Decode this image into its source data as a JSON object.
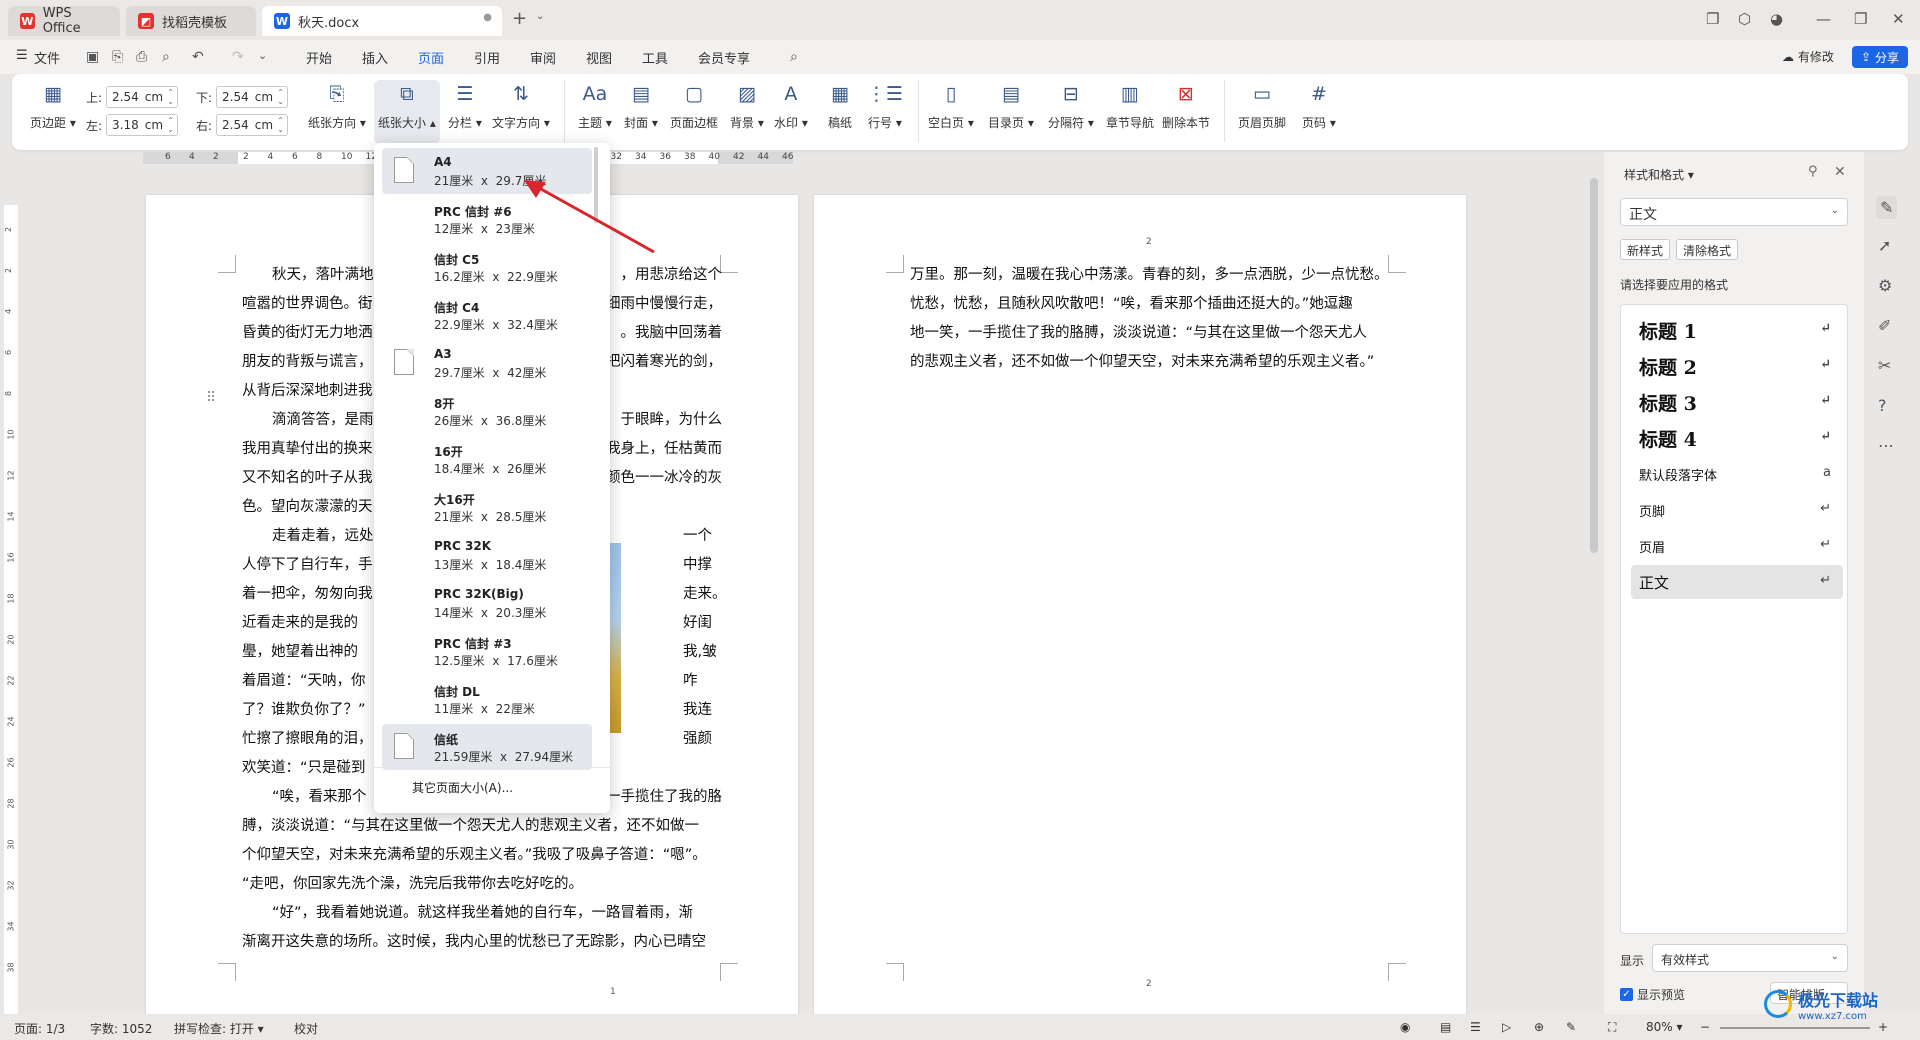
{
  "tabs": [
    {
      "label": "WPS Office"
    },
    {
      "label": "找稻壳模板"
    },
    {
      "label": "秋天.docx"
    }
  ],
  "menus": [
    "文件",
    "开始",
    "插入",
    "页面",
    "引用",
    "审阅",
    "视图",
    "工具",
    "会员专享"
  ],
  "right_top": {
    "revise": "有修改",
    "share": "分享"
  },
  "ribbon": {
    "margins": {
      "label": "页边距",
      "top_label": "上:",
      "top_val": "2.54",
      "bottom_label": "下:",
      "bottom_val": "2.54",
      "left_label": "左:",
      "left_val": "3.18",
      "right_label": "右:",
      "right_val": "2.54",
      "unit": "cm"
    },
    "buttons": [
      "纸张方向",
      "纸张大小",
      "分栏",
      "文字方向",
      "主题",
      "封面",
      "页面边框",
      "背景",
      "水印",
      "稿纸",
      "行号",
      "空白页",
      "目录页",
      "分隔符",
      "章节导航",
      "删除本节",
      "页眉页脚",
      "页码"
    ]
  },
  "ruler": [
    "6",
    "4",
    "2",
    "2",
    "4",
    "6",
    "8",
    "10",
    "12",
    "14",
    "16",
    "18",
    "20",
    "22",
    "24",
    "26",
    "28",
    "30",
    "32",
    "34",
    "36",
    "38",
    "40",
    "42",
    "44",
    "46"
  ],
  "vruler": [
    "2",
    "2",
    "4",
    "6",
    "8",
    "10",
    "12",
    "14",
    "16",
    "18",
    "20",
    "22",
    "24",
    "26",
    "28",
    "30",
    "32",
    "34",
    "38"
  ],
  "dropdown": {
    "items": [
      {
        "name": "A4",
        "w": "21厘米",
        "h": "29.7厘米"
      },
      {
        "name": "PRC 信封 #6",
        "w": "12厘米",
        "h": "23厘米"
      },
      {
        "name": "信封 C5",
        "w": "16.2厘米",
        "h": "22.9厘米"
      },
      {
        "name": "信封 C4",
        "w": "22.9厘米",
        "h": "32.4厘米"
      },
      {
        "name": "A3",
        "w": "29.7厘米",
        "h": "42厘米"
      },
      {
        "name": "8开",
        "w": "26厘米",
        "h": "36.8厘米"
      },
      {
        "name": "16开",
        "w": "18.4厘米",
        "h": "26厘米"
      },
      {
        "name": "大16开",
        "w": "21厘米",
        "h": "28.5厘米"
      },
      {
        "name": "PRC 32K",
        "w": "13厘米",
        "h": "18.4厘米"
      },
      {
        "name": "PRC 32K(Big)",
        "w": "14厘米",
        "h": "20.3厘米"
      },
      {
        "name": "PRC 信封 #3",
        "w": "12.5厘米",
        "h": "17.6厘米"
      },
      {
        "name": "信封 DL",
        "w": "11厘米",
        "h": "22厘米"
      },
      {
        "name": "信纸",
        "w": "21.59厘米",
        "h": "27.94厘米"
      }
    ],
    "x": "x",
    "more": "其它页面大小(A)..."
  },
  "page1": {
    "left_lines": [
      "秋天，落叶满地",
      "喧嚣的世界调色。街",
      "昏黄的街灯无力地洒",
      "朋友的背叛与谎言，",
      "从背后深深地刺进我",
      "滴滴答答，是雨",
      "我用真挚付出的换来",
      "又不知名的叶子从我",
      "色。望向灰濛濛的天",
      "走着走着，远处",
      "人停下了自行车，手",
      "着一把伞，匆匆向我",
      "近看走来的是我的",
      "璺，她望着出神的",
      "着眉道：“天呐，你",
      "了？谁欺负你了？”",
      "忙擦了擦眼角的泪，",
      "欢笑道：“只是碰到",
      "“唉，看来那个"
    ],
    "right_lines": [
      "，用悲凉给这个",
      "细雨中慢慢行走，",
      "。我脑中回荡着",
      "把闪着寒光的剑，",
      "",
      "于眼眸，为什么",
      "我身上，任枯黄而",
      "颜色一一冰冷的灰",
      "",
      "一个",
      "中撑",
      "走来。",
      "好闺",
      "我,皱",
      "咋",
      "我连",
      "强颜",
      "",
      "一手揽住了我的胳"
    ],
    "full_lines": [
      "膊，淡淡说道：“与其在这里做一个怨天尤人的悲观主义者，还不如做一",
      "个仰望天空，对未来充满希望的乐观主义者。”我吸了吸鼻子答道：“嗯”。",
      "“走吧，你回家先洗个澡，洗完后我带你去吃好吃的。",
      "“好”，我看着她说道。就这样我坐着她的自行车，一路冒着雨，渐",
      "渐离开这失意的场所。这时候，我内心里的忧愁已了无踪影，内心已晴空"
    ],
    "page_num": "1"
  },
  "page2": {
    "lines": [
      "万里。那一刻，温暖在我心中荡漾。青春的刻，多一点洒脱，少一点忧愁。",
      "忧愁，忧愁，且随秋风吹散吧！“唉，看来那个插曲还挺大的。”她逗趣",
      "地一笑，一手揽住了我的胳膊，淡淡说道：“与其在这里做一个怨天尤人",
      "的悲观主义者，还不如做一个仰望天空，对未来充满希望的乐观主义者。”"
    ],
    "header_num": "2",
    "page_num": "2"
  },
  "panel": {
    "title": "样式和格式",
    "current": "正文",
    "new_style": "新样式",
    "clear_format": "清除格式",
    "prompt": "请选择要应用的格式",
    "styles": [
      {
        "label": "标题  1",
        "kind": "h"
      },
      {
        "label": "标题  2",
        "kind": "h"
      },
      {
        "label": "标题  3",
        "kind": "h"
      },
      {
        "label": "标题  4",
        "kind": "h"
      },
      {
        "label": "默认段落字体",
        "kind": "n"
      },
      {
        "label": "页脚",
        "kind": "n"
      },
      {
        "label": "页眉",
        "kind": "n"
      },
      {
        "label": "正文",
        "kind": "sel"
      }
    ],
    "show_label": "显示",
    "show_value": "有效样式",
    "preview": "显示预览",
    "smart": "智能排版"
  },
  "status": {
    "page": "页面: 1/3",
    "words": "字数: 1052",
    "spell": "拼写检查: 打开",
    "proof": "校对",
    "zoom": "80%"
  },
  "watermark": {
    "text": "极光下载站",
    "url": "www.xz7.com"
  },
  "colors": {
    "accent": "#1a66e6",
    "wps_red": "#e5322d",
    "arrow": "#d9262b"
  }
}
